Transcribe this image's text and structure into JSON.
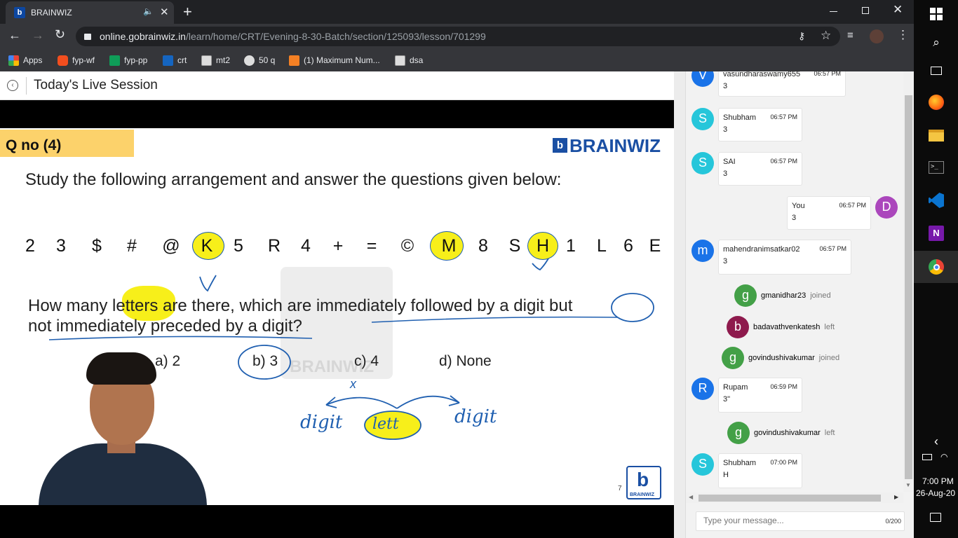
{
  "browser": {
    "tab_title": "BRAINWIZ",
    "url_domain": "online.gobrainwiz.in",
    "url_path": "/learn/home/CRT/Evening-8-30-Batch/section/125093/lesson/701299"
  },
  "bookmarks": [
    {
      "label": "Apps",
      "color": "#e8453c"
    },
    {
      "label": "fyp-wf",
      "color": "#f24e1e"
    },
    {
      "label": "fyp-pp",
      "color": "#0f9d58"
    },
    {
      "label": "crt",
      "color": "#1565c0"
    },
    {
      "label": "mt2",
      "color": "#ffffff"
    },
    {
      "label": "50 q",
      "color": "#ffffff"
    },
    {
      "label": "(1) Maximum Num...",
      "color": "#f48024"
    },
    {
      "label": "dsa",
      "color": "#ffffff"
    }
  ],
  "page": {
    "title": "Today's Live Session"
  },
  "slide": {
    "qno": "Q no (4)",
    "brand": "BRAINWIZ",
    "instruction": "Study the following arrangement and answer the questions given below:",
    "sequence": [
      "2",
      "3",
      "$",
      "#",
      "@",
      "K",
      "5",
      "R",
      "4",
      "+",
      "=",
      "©",
      "M",
      "8",
      "S",
      "H",
      "1",
      "L",
      "6",
      "E"
    ],
    "question_line1": "How many letters are there, which are immediately followed by a digit but",
    "question_line2": "not immediately preceded by a digit?",
    "options": [
      "a) 2",
      "b) 3",
      "c) 4",
      "d) None"
    ],
    "page_no": "7",
    "logo_caption": "BRAINWIZ",
    "watermark": "BRAINWIZ",
    "annotations": {
      "left": "digit",
      "center": "lett",
      "right": "digit",
      "mark": "x"
    }
  },
  "chat": {
    "messages": [
      {
        "type": "msg",
        "avatar": "V",
        "name": "vasundharaswamy655",
        "time": "06:57 PM",
        "text": "3",
        "color": "#1a73e8"
      },
      {
        "type": "msg",
        "avatar": "S",
        "name": "Shubham",
        "time": "06:57 PM",
        "text": "3",
        "color": "#26c6da"
      },
      {
        "type": "msg",
        "avatar": "S",
        "name": "SAI",
        "time": "06:57 PM",
        "text": "3",
        "color": "#26c6da"
      },
      {
        "type": "self",
        "avatar": "D",
        "name": "You",
        "time": "06:57 PM",
        "text": "3",
        "color": "#ab47bc"
      },
      {
        "type": "msg",
        "avatar": "m",
        "name": "mahendranimsatkar02",
        "time": "06:57 PM",
        "text": "3",
        "color": "#1a73e8"
      },
      {
        "type": "event",
        "avatar": "g",
        "name": "gmanidhar23",
        "action": "joined",
        "color": "#43a047"
      },
      {
        "type": "event",
        "avatar": "b",
        "name": "badavathvenkatesh",
        "action": "left",
        "color": "#8e1a4d"
      },
      {
        "type": "event",
        "avatar": "g",
        "name": "govindushivakumar",
        "action": "joined",
        "color": "#43a047"
      },
      {
        "type": "msg",
        "avatar": "R",
        "name": "Rupam",
        "time": "06:59 PM",
        "text": "3\"",
        "color": "#1a73e8"
      },
      {
        "type": "event",
        "avatar": "g",
        "name": "govindushivakumar",
        "action": "left",
        "color": "#43a047"
      },
      {
        "type": "msg",
        "avatar": "S",
        "name": "Shubham",
        "time": "07:00 PM",
        "text": "H",
        "color": "#26c6da"
      }
    ],
    "input_placeholder": "Type your message...",
    "char_count": "0/200"
  },
  "taskbar": {
    "time": "7:00 PM",
    "date": "26-Aug-20"
  }
}
